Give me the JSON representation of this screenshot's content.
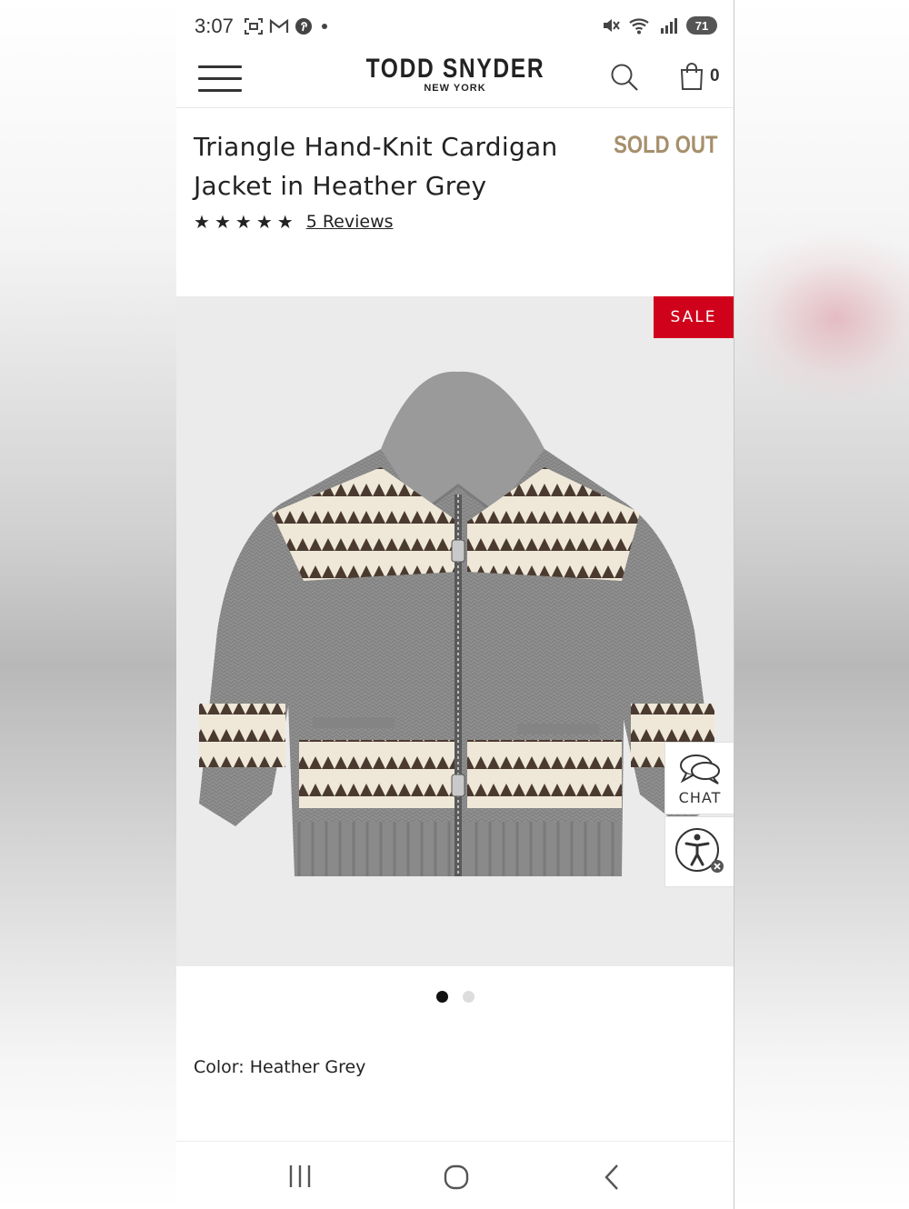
{
  "status_bar": {
    "time": "3:07",
    "left_icons": [
      "screenshot-icon",
      "gmail-icon",
      "pinterest-icon",
      "dot-icon"
    ],
    "right_icons": [
      "mute-icon",
      "wifi-icon",
      "signal-icon"
    ],
    "battery": "71"
  },
  "header": {
    "brand": "TODD SNYDER",
    "brand_sub": "NEW YORK",
    "bag_count": "0"
  },
  "product": {
    "title": "Triangle Hand-Knit Cardigan Jacket in Heather Grey",
    "status": "SOLD OUT",
    "rating": 5,
    "reviews_label": "5 Reviews",
    "badge": "SALE",
    "color_label": "Color: Heather Grey"
  },
  "carousel": {
    "total": 2,
    "active": 1
  },
  "widgets": {
    "chat_label": "CHAT"
  },
  "colors": {
    "sale_red": "#d0021b",
    "sold_out_gold": "#a68f6b",
    "image_bg": "#ebebeb"
  }
}
